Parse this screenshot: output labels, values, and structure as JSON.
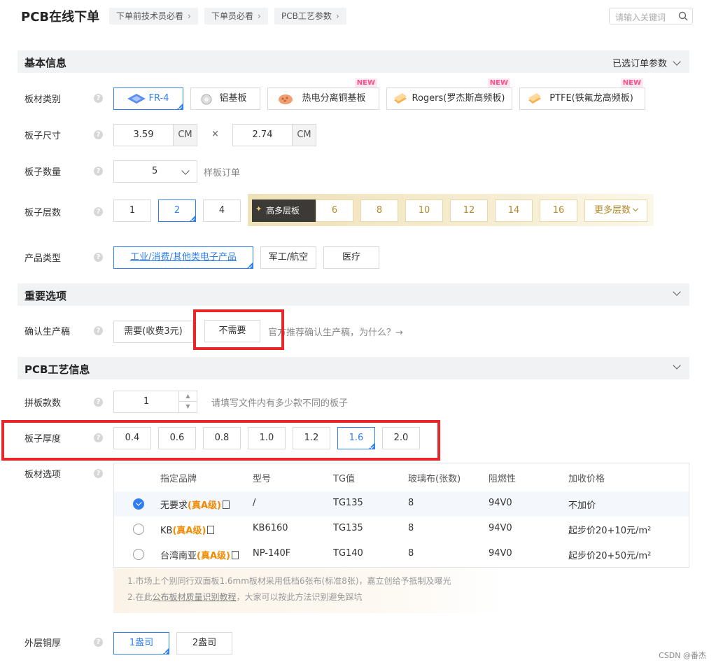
{
  "header": {
    "title": "PCB在线下单",
    "breadcrumbs": [
      "下单前技术员必看",
      "下单员必看",
      "PCB工艺参数"
    ],
    "search_placeholder": "请输入关键词"
  },
  "sections": {
    "basic": {
      "title": "基本信息",
      "right": "已选订单参数"
    },
    "important": {
      "title": "重要选项"
    },
    "process": {
      "title": "PCB工艺信息"
    }
  },
  "labels": {
    "material": "板材类别",
    "size": "板子尺寸",
    "quantity": "板子数量",
    "layers": "板子层数",
    "product": "产品类型",
    "confirm": "确认生产稿",
    "panel": "拼板款数",
    "thickness": "板子厚度",
    "board_option": "板材选项",
    "copper": "外层铜厚"
  },
  "help_glyph": "?",
  "material_options": [
    {
      "label": "FR-4",
      "new": ""
    },
    {
      "label": "铝基板",
      "new": ""
    },
    {
      "label": "热电分离铜基板",
      "new": "NEW"
    },
    {
      "label": "Rogers(罗杰斯高频板)",
      "new": "NEW"
    },
    {
      "label": "PTFE(铁氟龙高频板)",
      "new": "NEW"
    }
  ],
  "size": {
    "width": "3.59",
    "height": "2.74",
    "unit": "CM",
    "times": "×"
  },
  "quantity": {
    "value": "5",
    "hint": "样板订单"
  },
  "layers": {
    "basic": [
      "1",
      "2",
      "4"
    ],
    "badge": "高多层板",
    "advanced": [
      "6",
      "8",
      "10",
      "12",
      "14",
      "16"
    ],
    "more": "更多层数"
  },
  "product_types": [
    "工业/消费/其他类电子产品",
    "军工/航空",
    "医疗"
  ],
  "confirm": {
    "options": [
      "需要(收费3元)",
      "不需要"
    ],
    "hint": "官方推荐确认生产稿，为什么？→"
  },
  "panel": {
    "value": "1",
    "hint": "请填写文件内有多少款不同的板子"
  },
  "thickness_options": [
    "0.4",
    "0.6",
    "0.8",
    "1.0",
    "1.2",
    "1.6",
    "2.0"
  ],
  "board_table": {
    "headers": [
      "指定品牌",
      "型号",
      "TG值",
      "玻璃布(张数)",
      "阻燃性",
      "加收价格"
    ],
    "rows": [
      {
        "brand": "无要求",
        "grade": "(真A级)",
        "model": "/",
        "tg": "TG135",
        "glass": "8",
        "flame": "94V0",
        "price": "不加价",
        "selected": true
      },
      {
        "brand": "KB",
        "grade": "(真A级)",
        "model": "KB6160",
        "tg": "TG135",
        "glass": "8",
        "flame": "94V0",
        "price": "起步价20+10元/m²",
        "selected": false
      },
      {
        "brand": "台湾南亚",
        "grade": "(真A级)",
        "model": "NP-140F",
        "tg": "TG140",
        "glass": "8",
        "flame": "94V0",
        "price": "起步价20+50元/m²",
        "selected": false
      }
    ]
  },
  "notes": {
    "line1": "1.市场上个别同行双面板1.6mm板材采用低档6张布(标准8张)，嘉立创给予抵制及曝光",
    "line2_pre": "2.在此",
    "line2_link": "公布板材质量识别教程",
    "line2_post": "，大家可以按此方法识别避免踩坑"
  },
  "copper_options": [
    "1盎司",
    "2盎司"
  ],
  "watermark": "CSDN @番杰",
  "colors": {
    "accent": "#2f7ff0",
    "highlight": "#e8262a",
    "gold": "#b28a2a",
    "orange": "#f08a00"
  }
}
